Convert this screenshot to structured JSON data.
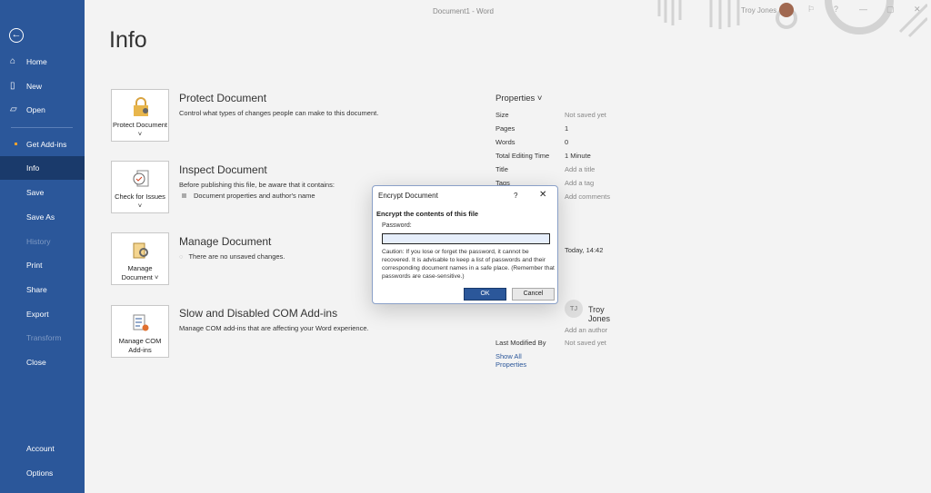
{
  "window": {
    "title": "Document1 - Word",
    "user": "Troy Jones",
    "controls": [
      "feedback-icon",
      "help",
      "minimize",
      "restore",
      "close"
    ]
  },
  "sidebar": {
    "back_icon": "back-arrow-icon",
    "items": [
      {
        "label": "Home",
        "icon": "home-icon"
      },
      {
        "label": "New",
        "icon": "new-doc-icon"
      },
      {
        "label": "Open",
        "icon": "folder-icon"
      },
      {
        "label": "Get Add-ins"
      },
      {
        "label": "Info",
        "selected": true
      },
      {
        "label": "Save"
      },
      {
        "label": "Save As"
      },
      {
        "label": "History",
        "disabled": true
      },
      {
        "label": "Print"
      },
      {
        "label": "Share"
      },
      {
        "label": "Export"
      },
      {
        "label": "Transform",
        "disabled": true
      },
      {
        "label": "Close"
      }
    ],
    "bottom": [
      {
        "label": "Account"
      },
      {
        "label": "Options"
      }
    ]
  },
  "page_title": "Info",
  "sections": [
    {
      "button": "Protect Document ˅",
      "title": "Protect Document",
      "desc": "Control what types of changes people can make to this document."
    },
    {
      "button": "Check for Issues ˅",
      "title": "Inspect Document",
      "desc": "Before publishing this file, be aware that it contains:",
      "bullet": "Document properties and author's name"
    },
    {
      "button": "Manage Document ˅",
      "title": "Manage Document",
      "desc": "There are no unsaved changes."
    },
    {
      "button": "Manage COM Add-ins",
      "title": "Slow and Disabled COM Add-ins",
      "desc": "Manage COM add-ins that are affecting your Word experience."
    }
  ],
  "properties": {
    "header": "Properties ˅",
    "rows": [
      {
        "k": "Size",
        "v": "Not saved yet"
      },
      {
        "k": "Pages",
        "v": "1"
      },
      {
        "k": "Words",
        "v": "0"
      },
      {
        "k": "Total Editing Time",
        "v": "1 Minute"
      },
      {
        "k": "Title",
        "v": "Add a title"
      },
      {
        "k": "Tags",
        "v": "Add a tag"
      },
      {
        "k": "",
        "v": "Add comments"
      }
    ],
    "created": "Today, 14:42",
    "author_initials": "TJ",
    "author": "Troy Jones",
    "add_author": "Add an author",
    "last_modified_label": "Last Modified By",
    "last_modified": "Not saved yet",
    "show_all": "Show All Properties"
  },
  "dialog": {
    "title": "Encrypt Document",
    "help": "?",
    "close": "✕",
    "heading": "Encrypt the contents of this file",
    "password_label": "Password:",
    "password_value": "",
    "caution": "Caution: If you lose or forget the password, it cannot be recovered. It is advisable to keep a list of passwords and their corresponding document names in a safe place. (Remember that passwords are case-sensitive.)",
    "ok": "OK",
    "cancel": "Cancel"
  },
  "colors": {
    "sidebar": "#2b579a",
    "selected": "#1a3a6b",
    "accent_dot": "#f0a030"
  }
}
